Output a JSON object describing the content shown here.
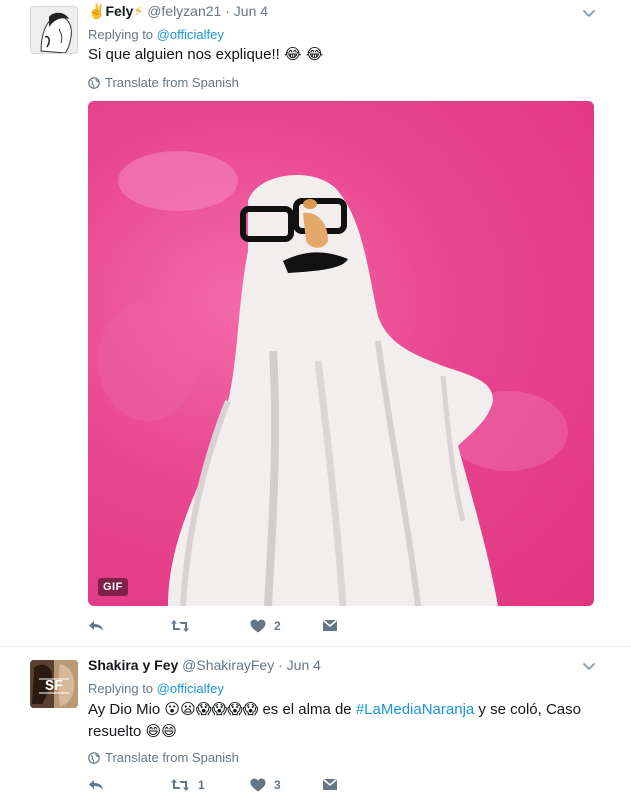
{
  "tweets": [
    {
      "display_name": "Fely",
      "handle": "@felyzan21",
      "separator": "·",
      "date": "Jun 4",
      "replying_prefix": "Replying to",
      "replying_to": "@officialfey",
      "text": "Si que alguien nos explique!!",
      "translate": "Translate from Spanish",
      "media_badge": "GIF",
      "retweets": "",
      "likes": "2"
    },
    {
      "display_name": "Shakira y Fey",
      "handle": "@ShakirayFey",
      "separator": "·",
      "date": "Jun 4",
      "replying_prefix": "Replying to",
      "replying_to": "@officialfey",
      "text_part1": "Ay Dio Mio",
      "text_part2": "es el alma de",
      "hashtag": "#LaMediaNaranja",
      "text_part3": "y se coló, Caso",
      "text_part4": "resuelto",
      "translate": "Translate from Spanish",
      "retweets": "1",
      "likes": "3"
    }
  ],
  "colors": {
    "link": "#1b95e0",
    "muted": "#657786",
    "gif_background": "#e8458f"
  },
  "icons": [
    "chevron-down-icon",
    "globe-icon",
    "reply-icon",
    "retweet-icon",
    "heart-icon",
    "message-icon"
  ]
}
